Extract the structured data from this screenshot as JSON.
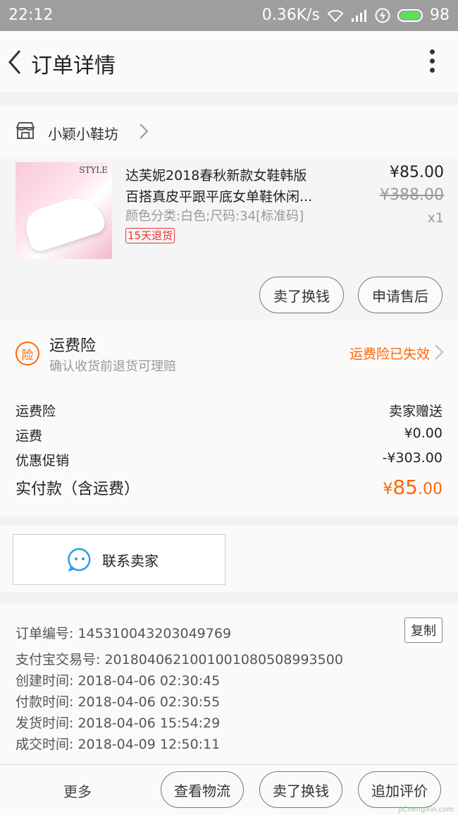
{
  "status_bar": {
    "time": "22:12",
    "speed": "0.36K/s",
    "battery": "98"
  },
  "nav": {
    "title": "订单详情"
  },
  "shop": {
    "name": "小颖小鞋坊"
  },
  "product": {
    "title_line1": "达芙妮2018春秋新款女鞋韩版",
    "title_line2": "百搭真皮平跟平底女单鞋休闲...",
    "image_text": "STYLE",
    "attrs": "颜色分类:白色;尺码:34[标准码]",
    "badge": "15天退货",
    "price": "¥85.00",
    "original_price": "¥388.00",
    "quantity": "x1",
    "buttons": [
      "卖了换钱",
      "申请售后"
    ]
  },
  "insurance": {
    "icon": "险",
    "title": "运费险",
    "subtitle": "确认收货前退货可理赔",
    "status": "运费险已失效"
  },
  "costs": [
    {
      "label": "运费险",
      "value": "卖家赠送"
    },
    {
      "label": "运费",
      "value": "¥0.00"
    },
    {
      "label": "优惠促销",
      "value": "-¥303.00"
    }
  ],
  "total": {
    "label": "实付款（含运费）",
    "currency": "¥",
    "main": "85",
    "decimals": ".00"
  },
  "contact": {
    "label": "联系卖家"
  },
  "order_info": {
    "order_no": "订单编号: 145310043203049769",
    "alipay_no": "支付宝交易号: 2018040621001001080508993500",
    "created": "创建时间: 2018-04-06 02:30:45",
    "paid": "付款时间: 2018-04-06 02:30:55",
    "shipped": "发货时间: 2018-04-06 15:54:29",
    "completed": "成交时间: 2018-04-09 12:50:11",
    "copy_label": "复制"
  },
  "bottom_bar": {
    "more": "更多",
    "buttons": [
      "查看物流",
      "卖了换钱",
      "追加评价"
    ]
  },
  "watermark": "JiChengXin.com",
  "colors": {
    "accent": "#ff6600",
    "badge": "#e33333",
    "status_bar": "#9e9e9e"
  }
}
